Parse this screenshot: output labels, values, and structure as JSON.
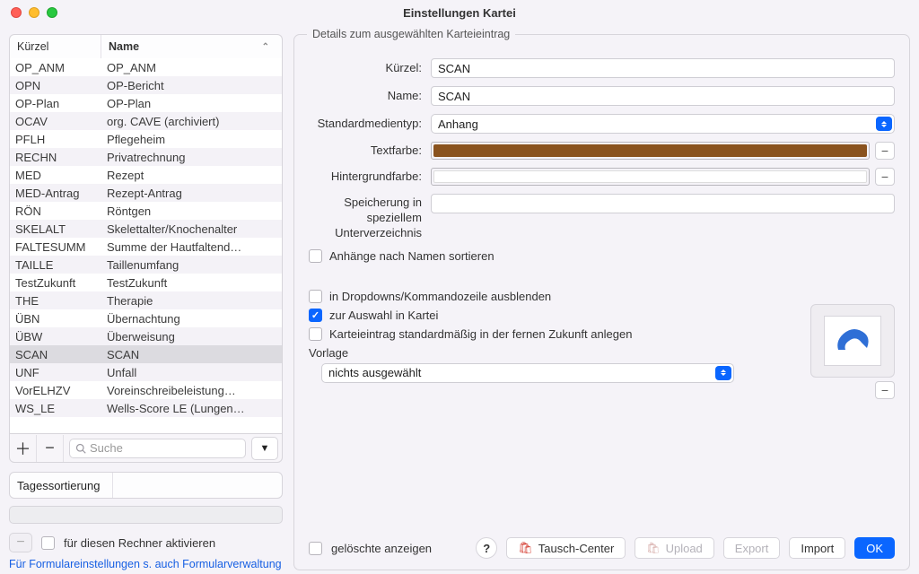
{
  "window": {
    "title": "Einstellungen Kartei"
  },
  "left": {
    "columns": {
      "kurzel": "Kürzel",
      "name": "Name"
    },
    "rows": [
      {
        "k": "OP_ANM",
        "n": "OP_ANM"
      },
      {
        "k": "OPN",
        "n": "OP-Bericht"
      },
      {
        "k": "OP-Plan",
        "n": "OP-Plan"
      },
      {
        "k": "OCAV",
        "n": "org. CAVE (archiviert)"
      },
      {
        "k": "PFLH",
        "n": "Pflegeheim"
      },
      {
        "k": "RECHN",
        "n": "Privatrechnung"
      },
      {
        "k": "MED",
        "n": "Rezept"
      },
      {
        "k": "MED-Antrag",
        "n": "Rezept-Antrag"
      },
      {
        "k": "RÖN",
        "n": "Röntgen"
      },
      {
        "k": "SKELALT",
        "n": "Skelettalter/Knochenalter"
      },
      {
        "k": "FALTESUMM",
        "n": "Summe der Hautfaltend…"
      },
      {
        "k": "TAILLE",
        "n": "Taillenumfang"
      },
      {
        "k": "TestZukunft",
        "n": "TestZukunft"
      },
      {
        "k": "THE",
        "n": "Therapie"
      },
      {
        "k": "ÜBN",
        "n": "Übernachtung"
      },
      {
        "k": "ÜBW",
        "n": "Überweisung"
      },
      {
        "k": "SCAN",
        "n": "SCAN",
        "selected": true
      },
      {
        "k": "UNF",
        "n": "Unfall"
      },
      {
        "k": "VorELHZV",
        "n": "Voreinschreibeleistung…"
      },
      {
        "k": "WS_LE",
        "n": "Wells-Score LE (Lungen…"
      }
    ],
    "search_placeholder": "Suche",
    "tagsort_label": "Tagessortierung",
    "activate_label": "für diesen Rechner aktivieren",
    "formlink": "Für Formulareinstellungen s. auch Formularverwaltung"
  },
  "details": {
    "groupTitle": "Details zum ausgewählten Karteieintrag",
    "labels": {
      "kurzel": "Kürzel:",
      "name": "Name:",
      "mediatype": "Standardmedientyp:",
      "textcolor": "Textfarbe:",
      "bgcolor": "Hintergrundfarbe:",
      "subdir": "Speicherung in speziellem Unterverzeichnis",
      "sortAttach": "Anhänge nach Namen sortieren",
      "hideDropdown": "in Dropdowns/Kommandozeile ausblenden",
      "selectable": "zur Auswahl in Kartei",
      "future": "Karteieintrag standardmäßig in der fernen Zukunft anlegen",
      "template": "Vorlage",
      "templateSel": "nichts ausgewählt"
    },
    "values": {
      "kurzel": "SCAN",
      "name": "SCAN",
      "mediatype": "Anhang",
      "textcolor": "#8a531e",
      "bgcolor": "#ffffff"
    },
    "checks": {
      "sortAttach": false,
      "hideDropdown": false,
      "selectable": true,
      "future": false
    }
  },
  "footer": {
    "showDeleted": "gelöschte anzeigen",
    "tausch": "Tausch-Center",
    "upload": "Upload",
    "export": "Export",
    "import": "Import",
    "ok": "OK"
  }
}
